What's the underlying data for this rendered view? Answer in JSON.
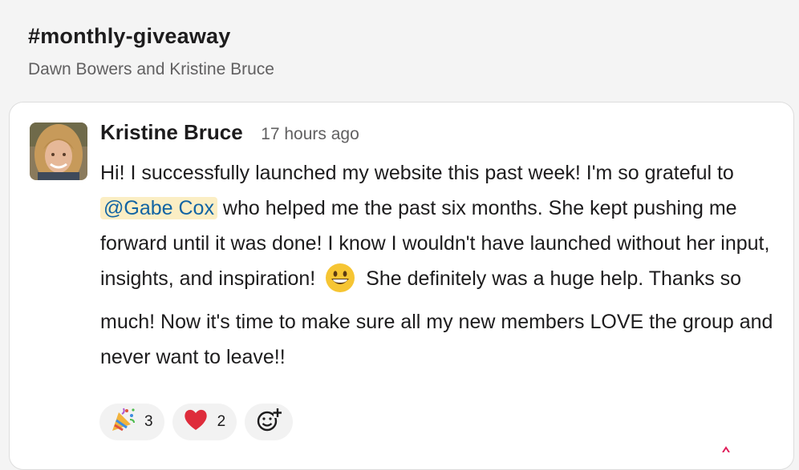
{
  "channel": {
    "name": "#monthly-giveaway",
    "members": "Dawn Bowers and Kristine Bruce"
  },
  "message": {
    "author": "Kristine Bruce",
    "timestamp": "17 hours ago",
    "line1": "Hi! I successfully launched my website this past week!  I'm so grateful to",
    "mention": "@Gabe Cox",
    "line2": "who helped me the past six months. She kept pushing me forward until it was done!  I know I wouldn't have launched without her input, insights, and inspiration!",
    "line3": "She definitely was a huge help. Thanks so much!     Now it's time to make sure all my new members LOVE the group and never want to leave!!",
    "inline_emoji": "grinning-face-icon"
  },
  "reactions": [
    {
      "icon": "party-popper-icon",
      "count": "3"
    },
    {
      "icon": "red-heart-icon",
      "count": "2"
    }
  ],
  "add_reaction_icon": "add-emoji-icon",
  "colors": {
    "mention_bg": "#fbeec4",
    "mention_text": "#1264a3",
    "background": "#f4f4f4"
  }
}
